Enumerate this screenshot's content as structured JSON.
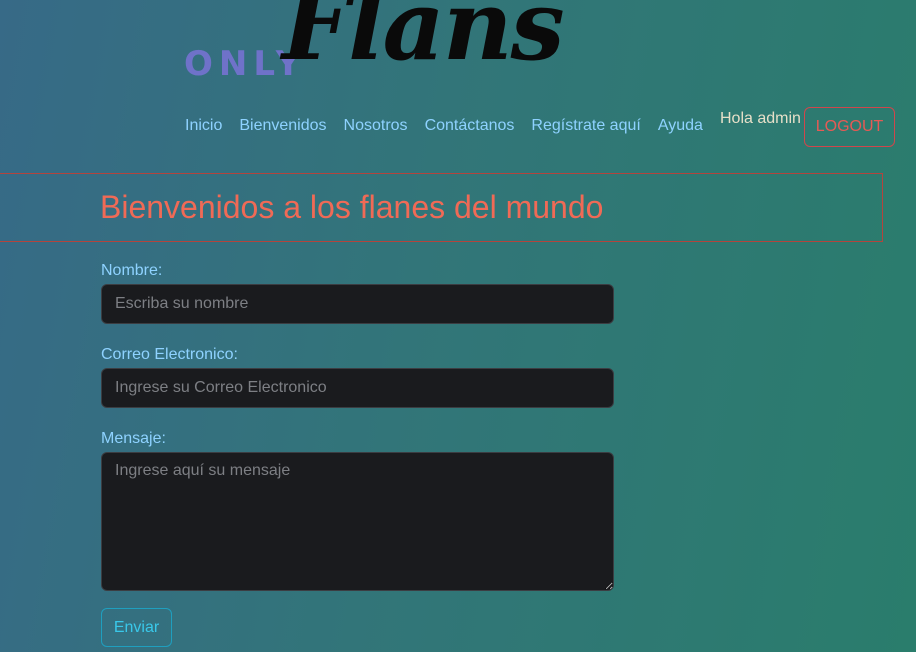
{
  "logo": {
    "prefix": "ONLY",
    "name": "Flans"
  },
  "nav": {
    "items": [
      {
        "label": "Inicio"
      },
      {
        "label": "Bienvenidos"
      },
      {
        "label": "Nosotros"
      },
      {
        "label": "Contáctanos"
      },
      {
        "label": "Regístrate aquí"
      },
      {
        "label": "Ayuda"
      }
    ],
    "greeting": "Hola admin",
    "logout_label": "LOGOUT"
  },
  "banner": {
    "title": "Bienvenidos a los flanes del mundo"
  },
  "form": {
    "name": {
      "label": "Nombre:",
      "placeholder": "Escriba su nombre",
      "value": ""
    },
    "email": {
      "label": "Correo Electronico:",
      "placeholder": "Ingrese su Correo Electronico",
      "value": ""
    },
    "message": {
      "label": "Mensaje:",
      "placeholder": "Ingrese aquí su mensaje",
      "value": ""
    },
    "submit_label": "Enviar"
  },
  "colors": {
    "nav_link": "#8ed2ff",
    "title": "#f06a56",
    "logout": "#e65a55",
    "submit": "#39c8ea",
    "logo_prefix": "#6f72c9"
  }
}
